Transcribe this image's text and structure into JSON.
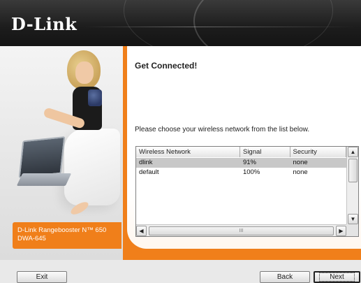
{
  "brand": {
    "logo_text": "D-Link"
  },
  "product": {
    "label_line1": "D-Link Rangebooster N™ 650",
    "label_line2": "DWA-645"
  },
  "wizard": {
    "title": "Get Connected!",
    "prompt": "Please choose your wireless network from the list below."
  },
  "network_list": {
    "columns": [
      "Wireless Network",
      "Signal",
      "Security"
    ],
    "rows": [
      {
        "name": "dlink",
        "signal": "91%",
        "security": "none",
        "selected": true
      },
      {
        "name": "default",
        "signal": "100%",
        "security": "none",
        "selected": false
      }
    ],
    "hscroll_grip": "III"
  },
  "buttons": {
    "exit": "Exit",
    "back": "Back",
    "next": "Next"
  },
  "icons": {
    "scroll_up": "chevron-up-icon",
    "scroll_down": "chevron-down-icon",
    "scroll_left": "chevron-left-icon",
    "scroll_right": "chevron-right-icon"
  },
  "colors": {
    "accent": "#f07f1a",
    "banner": "#1c1c1c",
    "selection": "#c8c8c8"
  }
}
